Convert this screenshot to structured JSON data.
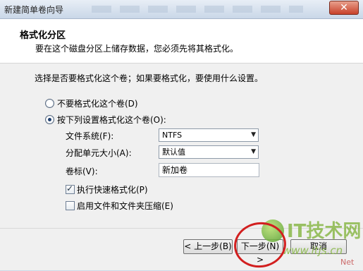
{
  "window": {
    "title": "新建简单卷向导",
    "close_symbol": "✕"
  },
  "header": {
    "title": "格式化分区",
    "subtitle": "要在这个磁盘分区上储存数据，您必须先将其格式化。"
  },
  "main": {
    "prompt": "选择是否要格式化这个卷；如果要格式化，要使用什么设置。",
    "options": [
      {
        "label": "不要格式化这个卷(D)",
        "selected": false
      },
      {
        "label": "按下列设置格式化这个卷(O):",
        "selected": true
      }
    ],
    "fields": {
      "filesystem_label": "文件系统(F):",
      "filesystem_value": "NTFS",
      "alloc_label": "分配单元大小(A):",
      "alloc_value": "默认值",
      "volume_label": "卷标(V):",
      "volume_value": "新加卷"
    },
    "checks": [
      {
        "label": "执行快速格式化(P)",
        "checked": true
      },
      {
        "label": "启用文件和文件夹压缩(E)",
        "checked": false
      }
    ]
  },
  "footer": {
    "back_label": "< 上一步(B)",
    "next_label": "下一步(N) >",
    "cancel_label": "取消"
  },
  "watermark": {
    "brand": "IT技术网",
    "url": "www.itjs.cn",
    "suffix": "Net"
  },
  "colors": {
    "annotation_circle": "#d21f1f",
    "watermark_green": "#8ab84a"
  }
}
